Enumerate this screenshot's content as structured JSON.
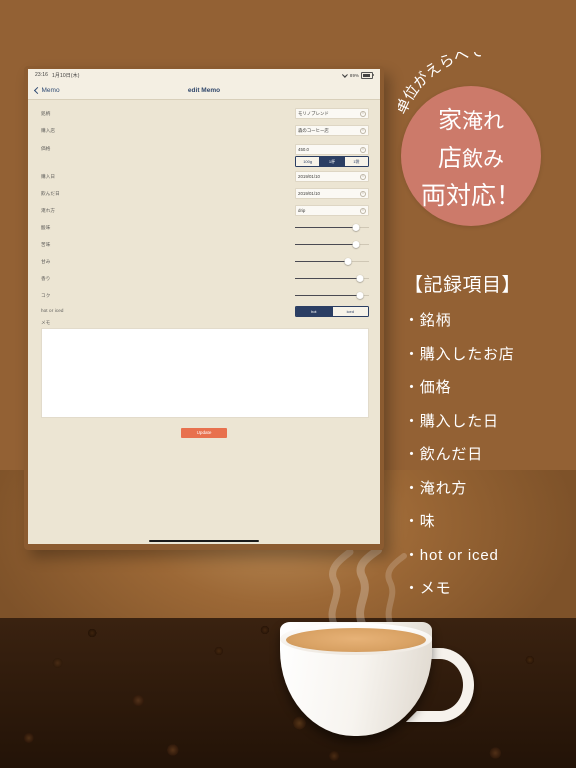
{
  "device": {
    "statusbar": {
      "time": "23:16",
      "date": "1月10日(木)",
      "battery": "89%",
      "wifi_icon": "wifi-icon",
      "battery_icon": "battery-icon"
    },
    "navbar": {
      "back_label": "Memo",
      "back_icon": "chevron-left-icon",
      "title": "edit Memo"
    },
    "form": {
      "fields": [
        {
          "label": "銘柄",
          "value": "モリノブレンド",
          "clear_icon": "clear-icon"
        },
        {
          "label": "購入店",
          "value": "森のコーヒー店",
          "clear_icon": "clear-icon"
        },
        {
          "label": "価格",
          "value": "450.0",
          "clear_icon": "clear-icon"
        }
      ],
      "unit_segment": {
        "options": [
          "100g",
          "1杯",
          "1袋"
        ],
        "selected": "1杯"
      },
      "date_fields": [
        {
          "label": "購入日",
          "value": "2019/01/10",
          "clear_icon": "clear-icon"
        },
        {
          "label": "飲んだ日",
          "value": "2019/01/10",
          "clear_icon": "clear-icon"
        },
        {
          "label": "淹れ方",
          "value": "drip",
          "clear_icon": "clear-icon"
        }
      ],
      "sliders": [
        {
          "label": "酸味",
          "value": 82
        },
        {
          "label": "苦味",
          "value": 82
        },
        {
          "label": "甘み",
          "value": 72
        },
        {
          "label": "香り",
          "value": 88
        },
        {
          "label": "コク",
          "value": 88
        }
      ],
      "hot_or_iced": {
        "label": "hot or iced",
        "options": [
          "hot",
          "iced"
        ],
        "selected": "hot"
      },
      "memo": {
        "label": "メモ",
        "value": "",
        "placeholder": ""
      },
      "update_button": "Update"
    }
  },
  "marketing": {
    "curved_text": "単位がえらべて",
    "badge": {
      "line1_kanji": "家",
      "line1_rest": "淹れ",
      "line2_kanji": "店",
      "line2_rest": "飲み",
      "line3": "両対応！",
      "color": "#cc7a6a"
    },
    "features": {
      "title": "【記録項目】",
      "items": [
        "・銘柄",
        "・購入したお店",
        "・価格",
        "・購入した日",
        "・飲んだ日",
        "・淹れ方",
        "・味",
        "・hot or iced",
        "・メモ"
      ]
    }
  },
  "background": {
    "color": "#936134",
    "photo_alt": "steaming-coffee-cup-on-beans"
  }
}
